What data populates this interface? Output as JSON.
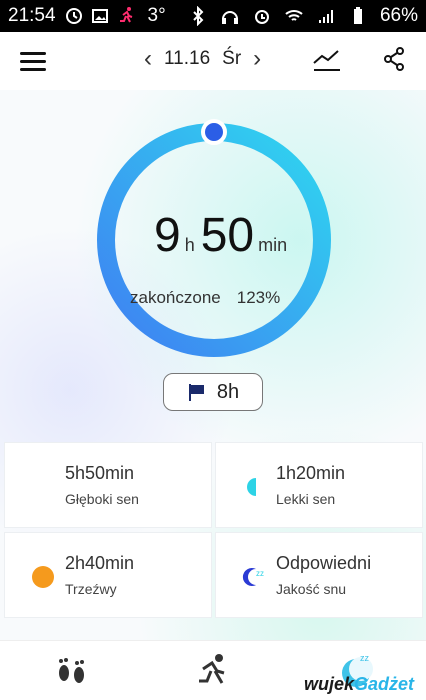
{
  "status_bar": {
    "time": "21:54",
    "temperature": "3°",
    "battery": "66%"
  },
  "header": {
    "date": "11.16",
    "day": "Śr",
    "prev_icon": "chevron-left-icon",
    "next_icon": "chevron-right-icon"
  },
  "summary": {
    "hours": "9",
    "hours_unit": "h",
    "minutes": "50",
    "minutes_unit": "min",
    "completed_label": "zakończone",
    "completed_percent": "123%",
    "ring_progress": 1.0
  },
  "goal": {
    "value": "8h"
  },
  "cards": [
    {
      "value": "5h50min",
      "label": "Głęboki sen",
      "icon": "moon-icon"
    },
    {
      "value": "1h20min",
      "label": "Lekki sen",
      "icon": "half-circle-icon"
    },
    {
      "value": "2h40min",
      "label": "Trzeźwy",
      "icon": "sun-dot-icon"
    },
    {
      "value": "Odpowiedni",
      "label": "Jakość snu",
      "icon": "sleep-quality-icon"
    }
  ],
  "bottom_tabs": [
    {
      "icon": "footprints-icon"
    },
    {
      "icon": "running-icon"
    },
    {
      "icon": "sleep-icon"
    }
  ],
  "watermark": {
    "part1": "wujek",
    "part2": "Gadżet"
  }
}
